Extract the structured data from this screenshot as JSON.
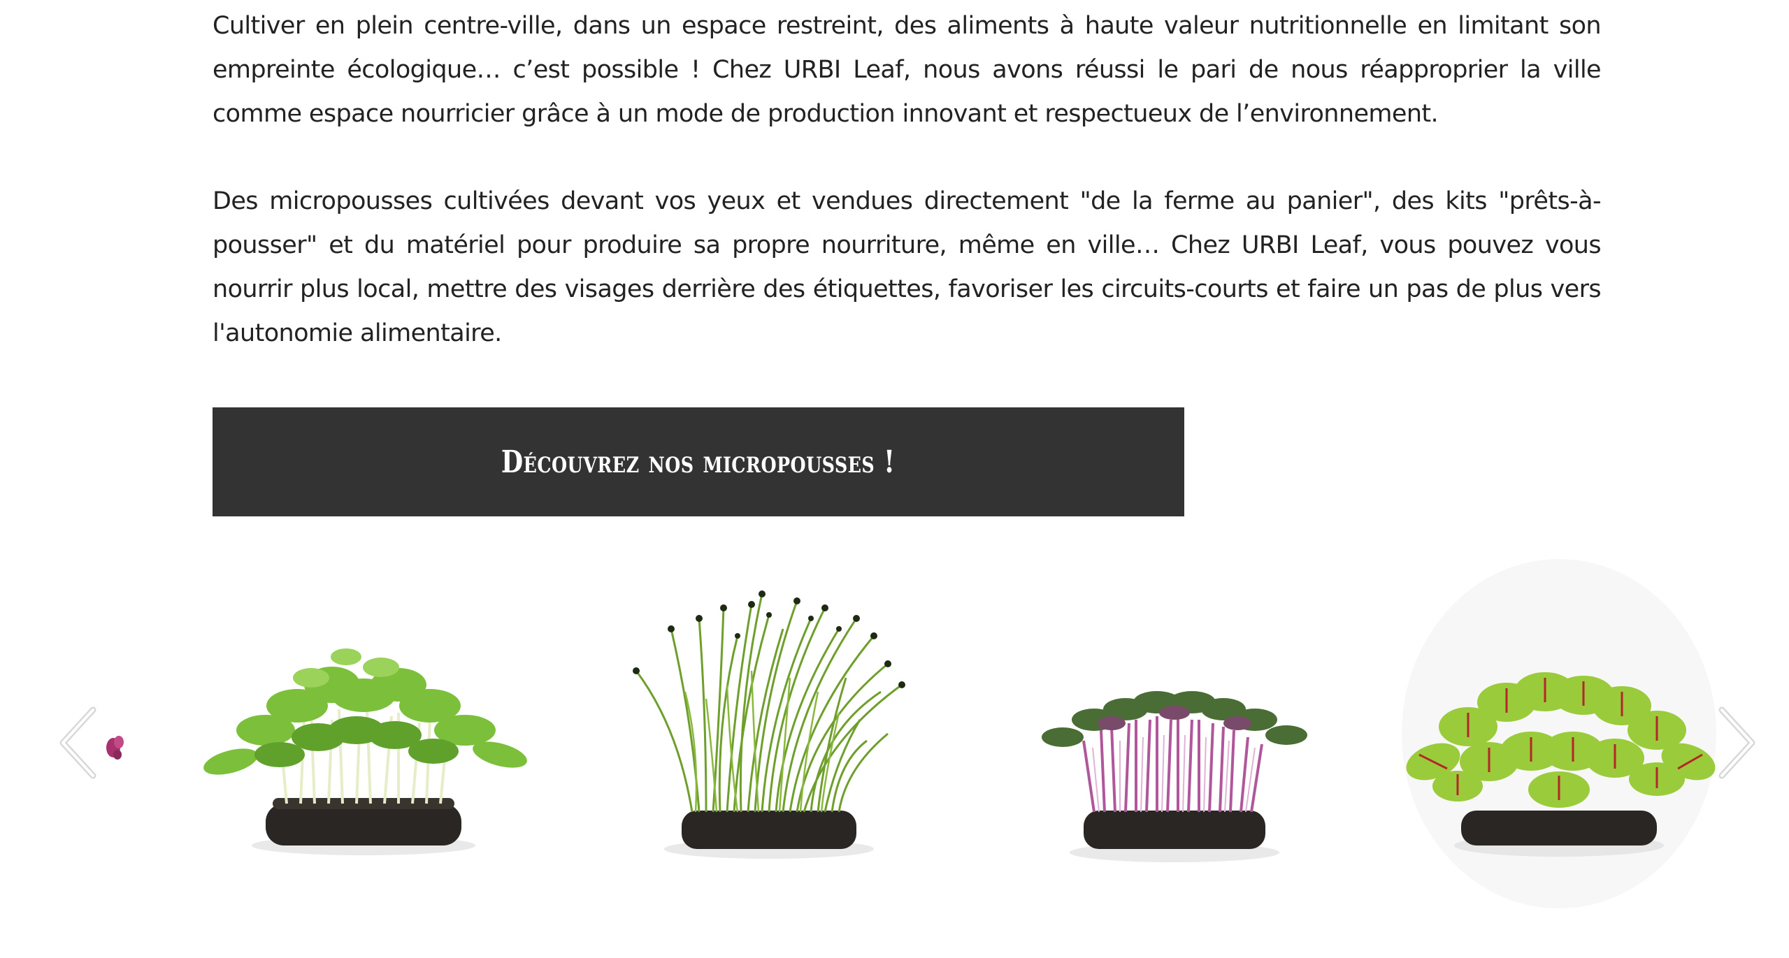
{
  "intro": {
    "paragraph_1": "Cultiver en plein centre-ville, dans un espace restreint, des aliments à haute valeur nutritionnelle en limitant son empreinte écologique… c’est possible ! Chez URBI Leaf, nous avons réussi le pari de nous réapproprier la ville comme espace nourricier grâce à un mode de production innovant et respectueux de l’environnement.",
    "paragraph_2": "Des micropousses cultivées devant vos yeux et vendues directement \"de la ferme au panier\", des kits \"prêts-à-pousser\" et du matériel pour produire sa propre nourriture, même en ville… Chez URBI Leaf, vous pouvez vous nourrir plus local, mettre des visages derrière des étiquettes, favoriser les circuits-courts et faire un pas de plus vers l'autonomie alimentaire."
  },
  "cta": {
    "label": "Découvrez nos micropousses !"
  },
  "gallery": {
    "icons": {
      "previous": "chevron-left-icon",
      "next": "chevron-right-icon"
    },
    "slides": [
      {
        "image": "sunflower-microgreens-image",
        "accent": "#7cbf3a"
      },
      {
        "image": "chive-microgreens-image",
        "accent": "#6e9f2c"
      },
      {
        "image": "purple-radish-microgreens-image",
        "accent": "#b0569b"
      },
      {
        "image": "red-veined-sorrel-microgreens-image",
        "accent": "#9acb3a"
      }
    ]
  },
  "colors": {
    "button_background": "#333333",
    "button_text": "#ffffff",
    "body_text": "#222222"
  }
}
